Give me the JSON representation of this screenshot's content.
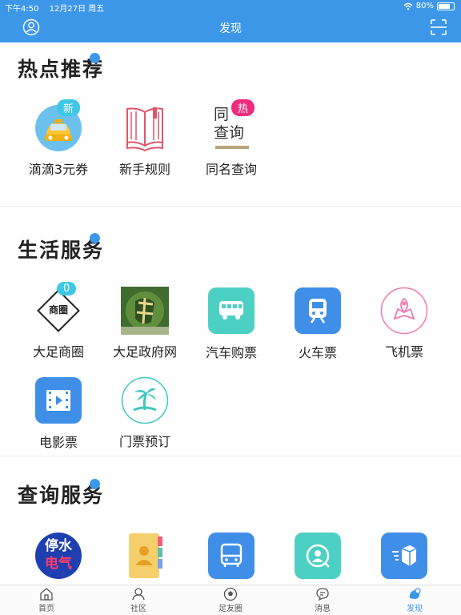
{
  "status_bar": {
    "time": "下午4:50",
    "date": "12月27日 周五",
    "battery": "80%",
    "battery_level": 0.8
  },
  "nav": {
    "title": "发现"
  },
  "hot": {
    "title": "热点推荐",
    "items": [
      {
        "label": "滴滴3元券",
        "badge": "新"
      },
      {
        "label": "新手规则"
      },
      {
        "label": "同名查询",
        "badge": "热",
        "icon_text_1": "同",
        "icon_text_2": "查询"
      }
    ]
  },
  "life": {
    "title": "生活服务",
    "items": [
      {
        "label": "大足商圈",
        "badge": "0",
        "icon_text": "商圈"
      },
      {
        "label": "大足政府网"
      },
      {
        "label": "汽车购票"
      },
      {
        "label": "火车票"
      },
      {
        "label": "飞机票"
      },
      {
        "label": "电影票"
      },
      {
        "label": "门票预订"
      }
    ]
  },
  "query": {
    "title": "查询服务",
    "items": [
      {
        "name": "utility-outage",
        "icon_text_1": "停水",
        "icon_text_2": "电气"
      },
      {
        "name": "contacts"
      },
      {
        "name": "bus"
      },
      {
        "name": "person-search"
      },
      {
        "name": "express"
      }
    ]
  },
  "tabs": [
    {
      "label": "首页",
      "icon": "home-icon"
    },
    {
      "label": "社区",
      "icon": "community-icon"
    },
    {
      "label": "足友圈",
      "icon": "football-icon"
    },
    {
      "label": "消息",
      "icon": "message-icon"
    },
    {
      "label": "发现",
      "icon": "discover-icon",
      "active": true
    }
  ],
  "colors": {
    "primary": "#3d97e8",
    "hot_badge": "#ee2c7f",
    "new_badge": "#3fc8e6",
    "teal": "#4dd0c4",
    "blue": "#3f8fe8"
  }
}
